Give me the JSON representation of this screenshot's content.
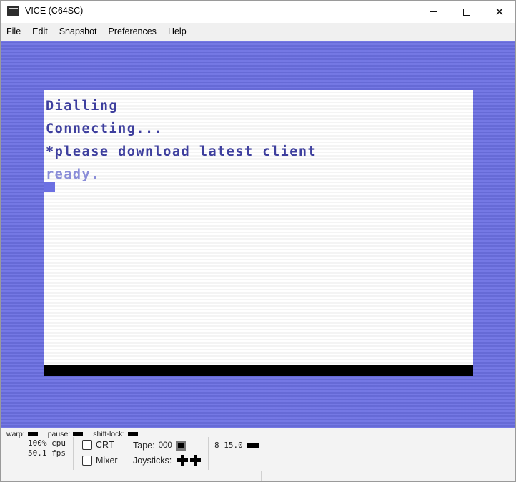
{
  "window": {
    "title": "VICE (C64SC)"
  },
  "menu": [
    "File",
    "Edit",
    "Snapshot",
    "Preferences",
    "Help"
  ],
  "screen": {
    "lines": [
      "Dialling",
      "Connecting...",
      "*please download latest client",
      "ready."
    ],
    "colors": {
      "border": "#6c70e2",
      "background": "#fbfbfb",
      "text": "#3e3f9e",
      "ready": "#8a8dd8"
    }
  },
  "status": {
    "warp_label": "warp:",
    "pause_label": "pause:",
    "shiftlock_label": "shift-lock:",
    "cpu": "100% cpu",
    "fps": "50.1 fps",
    "crt_label": "CRT",
    "mixer_label": "Mixer",
    "tape_label": "Tape:",
    "tape_counter": "000",
    "joysticks_label": "Joysticks:",
    "drive_status": "8 15.0"
  }
}
